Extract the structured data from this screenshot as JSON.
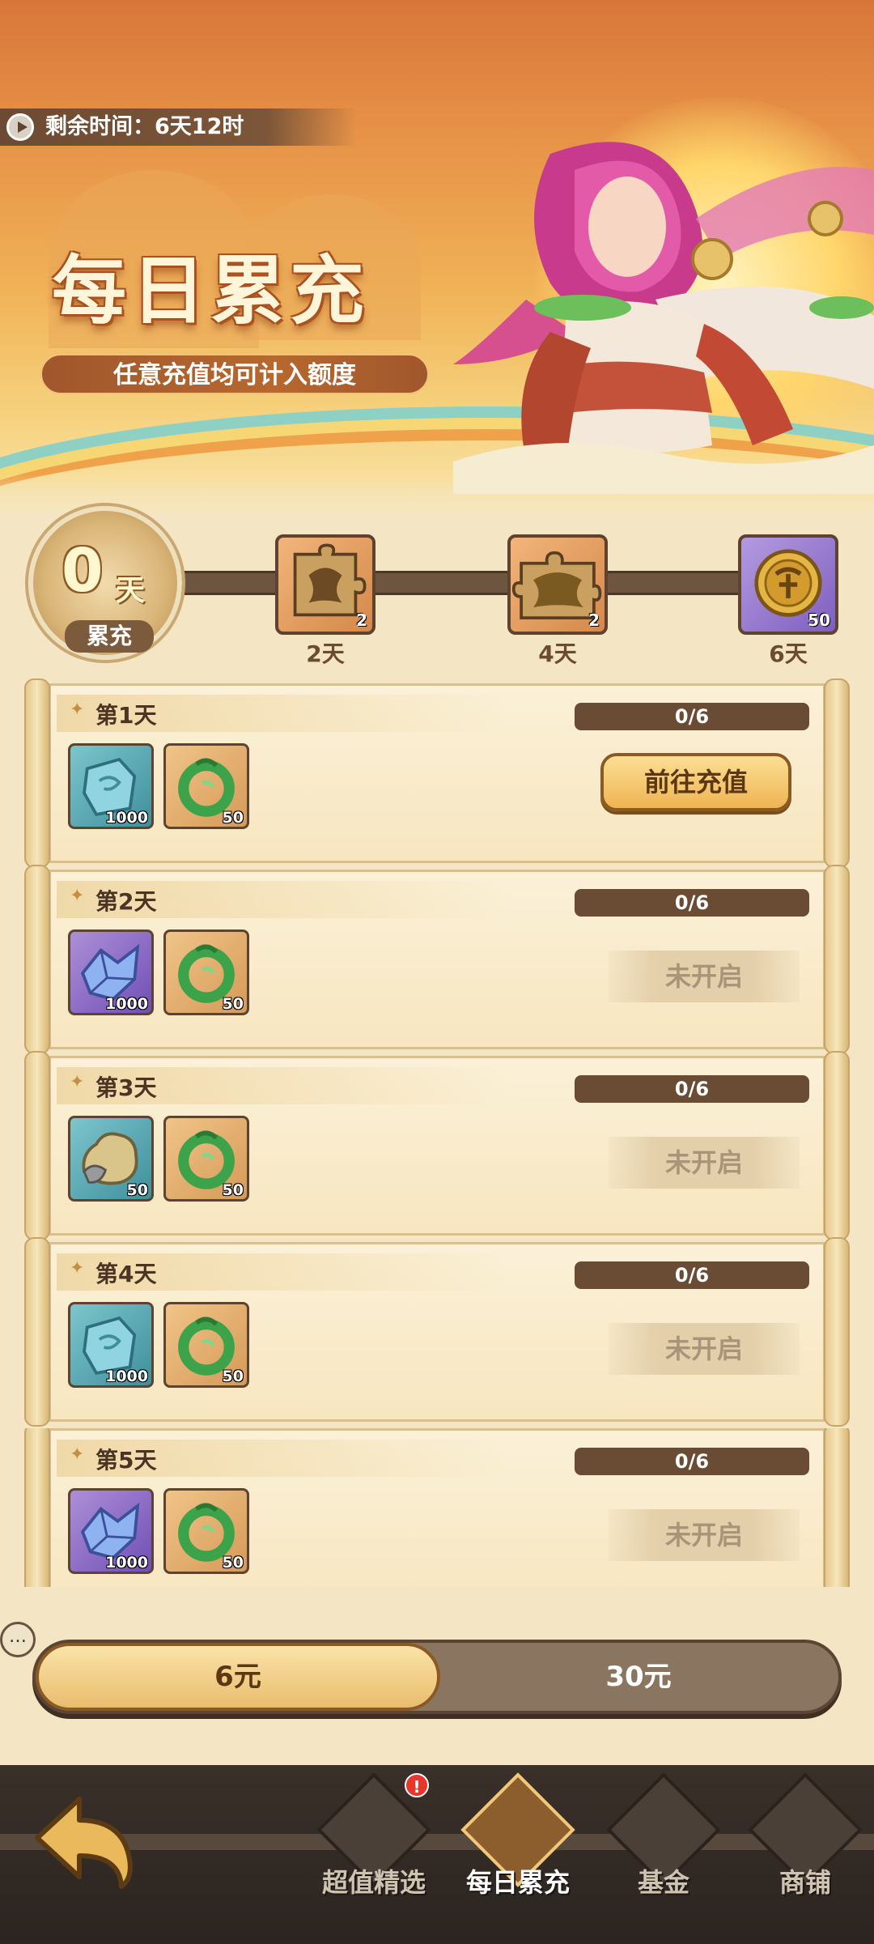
{
  "header": {
    "timer_label": "剩余时间：6天12时",
    "title": "每日累充",
    "subtitle": "任意充值均可计入额度"
  },
  "progress": {
    "days": "0",
    "days_unit": "天",
    "days_label": "累充",
    "milestones": [
      {
        "label": "2天",
        "count": "2",
        "icon": "puzzle-fragment-icon"
      },
      {
        "label": "4天",
        "count": "2",
        "icon": "puzzle-fragment-icon"
      },
      {
        "label": "6天",
        "count": "50",
        "icon": "gold-coin-icon"
      }
    ]
  },
  "tasks": [
    {
      "title": "第1天",
      "progress": "0/6",
      "button": "前往充值",
      "status": "active",
      "rewards": [
        {
          "icon": "blue-crystal-icon",
          "count": "1000"
        },
        {
          "icon": "jade-ring-icon",
          "count": "50"
        }
      ]
    },
    {
      "title": "第2天",
      "progress": "0/6",
      "button": "未开启",
      "status": "locked",
      "rewards": [
        {
          "icon": "purple-crystal-icon",
          "count": "1000"
        },
        {
          "icon": "jade-ring-icon",
          "count": "50"
        }
      ]
    },
    {
      "title": "第3天",
      "progress": "0/6",
      "button": "未开启",
      "status": "locked",
      "rewards": [
        {
          "icon": "ore-stone-icon",
          "count": "50"
        },
        {
          "icon": "jade-ring-icon",
          "count": "50"
        }
      ]
    },
    {
      "title": "第4天",
      "progress": "0/6",
      "button": "未开启",
      "status": "locked",
      "rewards": [
        {
          "icon": "blue-crystal-icon",
          "count": "1000"
        },
        {
          "icon": "jade-ring-icon",
          "count": "50"
        }
      ]
    },
    {
      "title": "第5天",
      "progress": "0/6",
      "button": "未开启",
      "status": "locked",
      "rewards": [
        {
          "icon": "purple-crystal-icon",
          "count": "1000"
        },
        {
          "icon": "jade-ring-icon",
          "count": "50"
        }
      ]
    }
  ],
  "tiers": {
    "selected": "6元",
    "other": "30元"
  },
  "nav": {
    "tabs": [
      "超值精选",
      "每日累充",
      "基金",
      "商铺"
    ],
    "badge": "!"
  },
  "colors": {
    "accent": "#efb452",
    "dark_brown": "#6a4b33",
    "paper": "#fbf1d8"
  }
}
